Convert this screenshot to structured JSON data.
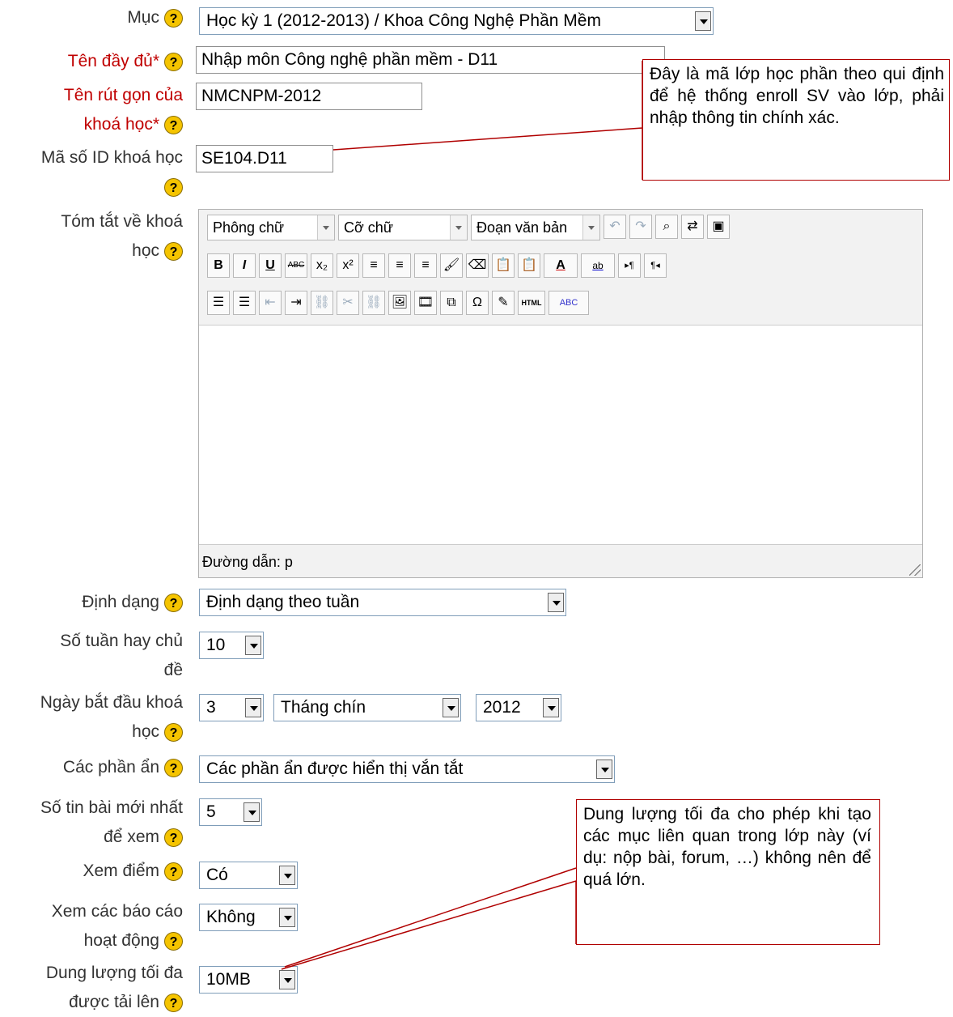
{
  "help_glyph": "?",
  "fields": {
    "muc": {
      "label": "Mục",
      "value": "Học kỳ 1 (2012-2013) / Khoa Công Nghệ Phần Mềm"
    },
    "fullname": {
      "label": "Tên đầy đủ*",
      "value": "Nhập môn Công nghệ phần mềm - D11"
    },
    "shortname": {
      "label_line1": "Tên rút gọn của",
      "label_line2": "khoá học*",
      "value": "NMCNPM-2012"
    },
    "idnumber": {
      "label": "Mã số ID khoá học",
      "value": "SE104.D11"
    },
    "summary": {
      "label_line1": "Tóm tắt về khoá",
      "label_line2": "học"
    },
    "format": {
      "label": "Định dạng",
      "value": "Định dạng theo tuần"
    },
    "numsections": {
      "label_line1": "Số tuần hay chủ",
      "label_line2": "đề",
      "value": "10"
    },
    "startdate": {
      "label_line1": "Ngày bắt đầu khoá",
      "label_line2": "học",
      "day": "3",
      "month": "Tháng chín",
      "year": "2012"
    },
    "hiddensections": {
      "label": "Các phần ẩn",
      "value": "Các phần ẩn được hiển thị vắn tắt"
    },
    "newsitems": {
      "label_line1": "Số tin bài mới nhất",
      "label_line2": "để xem",
      "value": "5"
    },
    "showgrades": {
      "label": "Xem điểm",
      "value": "Có"
    },
    "showreports": {
      "label_line1": "Xem các báo cáo",
      "label_line2": "hoạt động",
      "value": "Không"
    },
    "maxbytes": {
      "label_line1": "Dung lượng tối đa",
      "label_line2": "được tải lên",
      "value": "10MB"
    }
  },
  "editor": {
    "font_select": "Phông chữ",
    "size_select": "Cỡ chữ",
    "format_select": "Đoạn văn bản",
    "path_label": "Đường dẫn: p",
    "buttons_row2": [
      "B",
      "I",
      "U",
      "ABC",
      "x₂",
      "x²",
      "≡",
      "≡",
      "≡",
      "🖌",
      "⌫",
      "📋",
      "📋",
      "A",
      "ab",
      "▸¶",
      "¶◂"
    ],
    "buttons_row3": [
      "☰",
      "☰",
      "⇤",
      "⇥",
      "⛓",
      "✂",
      "⛓",
      "🖼",
      "🎞",
      "⧉",
      "Ω",
      "✎",
      "HTML",
      "ABC"
    ]
  },
  "callouts": {
    "idnumber_note": "Đây là mã lớp học phần theo qui định để hệ thống enroll SV vào lớp, phải nhập thông tin chính xác.",
    "maxbytes_note": "Dung lượng tối đa cho phép khi tạo các mục liên quan trong lớp này (ví dụ: nộp bài, forum, …) không nên để quá lớn."
  },
  "colors": {
    "required_label": "#c00000",
    "callout_border": "#b00000",
    "help_icon": "#f5c400"
  }
}
